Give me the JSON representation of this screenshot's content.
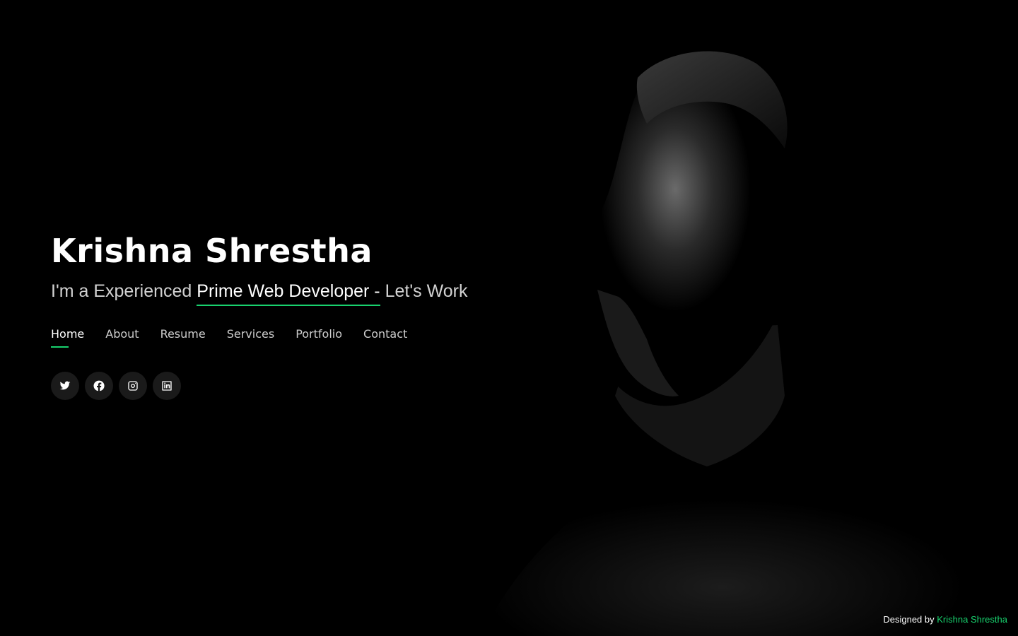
{
  "hero": {
    "name": "Krishna Shrestha",
    "tagline_prefix": "I'm a Experienced",
    "tagline_highlight": "Prime Web Developer -",
    "tagline_suffix": "Let's Work"
  },
  "nav": {
    "items": [
      {
        "label": "Home",
        "active": true
      },
      {
        "label": "About"
      },
      {
        "label": "Resume"
      },
      {
        "label": "Services"
      },
      {
        "label": "Portfolio"
      },
      {
        "label": "Contact"
      }
    ]
  },
  "social": {
    "icons": [
      "twitter-icon",
      "facebook-icon",
      "instagram-icon",
      "linkedin-icon"
    ]
  },
  "credits": {
    "prefix": "Designed by",
    "author": "Krishna Shrestha"
  },
  "colors": {
    "accent": "#18d26e",
    "background": "#000000",
    "text": "#ffffff"
  }
}
